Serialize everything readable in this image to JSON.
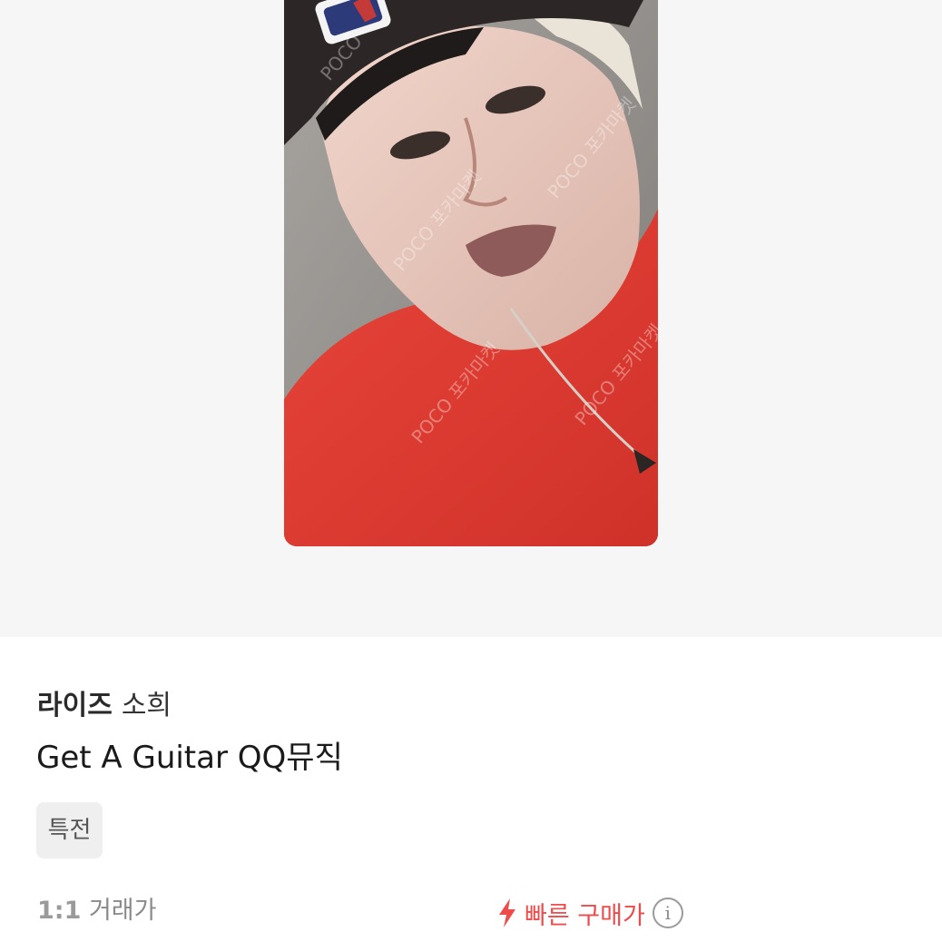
{
  "product": {
    "group": "라이즈",
    "member": "소희",
    "title": "Get A Guitar QQ뮤직",
    "tag": "특전"
  },
  "image": {
    "description": "photocard-photo",
    "watermark": "POCO 포카마켓",
    "cap_logo_text": "MLB"
  },
  "pricing": {
    "ratio": "1:1",
    "trade_label": "거래가",
    "quick_buy_label": "빠른 구매가",
    "accent_color": "#ef4b4b",
    "info_icon": "info-icon",
    "bolt_icon": "lightning-bolt-icon"
  }
}
